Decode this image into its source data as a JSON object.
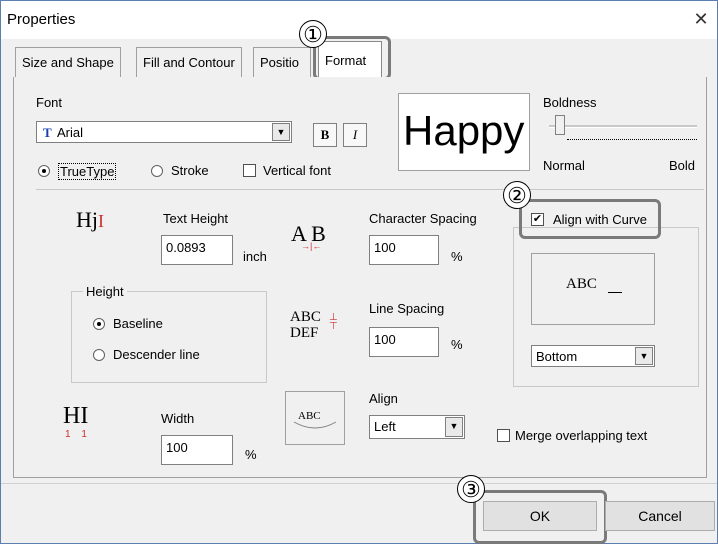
{
  "window": {
    "title": "Properties",
    "close_glyph": "✕"
  },
  "tabs": [
    {
      "label": "Size and Shape"
    },
    {
      "label": "Fill and Contour"
    },
    {
      "label": "Positio"
    },
    {
      "label": "Format"
    }
  ],
  "font": {
    "label": "Font",
    "selected": "Arial",
    "bold_label": "B",
    "italic_label": "I",
    "preview_text": "Happy",
    "types": [
      {
        "label": "TrueType",
        "selected": true
      },
      {
        "label": "Stroke",
        "selected": false
      }
    ],
    "vertical_label": "Vertical font",
    "vertical_checked": false
  },
  "boldness": {
    "label": "Boldness",
    "min_label": "Normal",
    "max_label": "Bold",
    "level": 0.0
  },
  "text_height": {
    "label": "Text Height",
    "value": "0.0893",
    "unit": "inch",
    "icon_text": "Hj"
  },
  "char_spacing": {
    "label": "Character Spacing",
    "value": "100",
    "unit": "%",
    "icon_text": "A B"
  },
  "line_spacing": {
    "label": "Line Spacing",
    "value": "100",
    "unit": "%",
    "icon_line1": "ABC",
    "icon_line2": "DEF"
  },
  "height_group": {
    "label": "Height",
    "options": [
      {
        "label": "Baseline",
        "selected": true
      },
      {
        "label": "Descender line",
        "selected": false
      }
    ]
  },
  "width": {
    "label": "Width",
    "value": "100",
    "unit": "%",
    "icon_text": "HI",
    "icon_ticks": "1 1"
  },
  "align": {
    "label": "Align",
    "value": "Left",
    "preview_text": "ABC"
  },
  "curve": {
    "label": "Align with Curve",
    "checked": true,
    "preview_text": "ABC",
    "position": "Bottom"
  },
  "merge": {
    "label": "Merge overlapping text",
    "checked": false
  },
  "buttons": {
    "ok": "OK",
    "cancel": "Cancel"
  },
  "callouts": [
    "①",
    "②",
    "③"
  ]
}
